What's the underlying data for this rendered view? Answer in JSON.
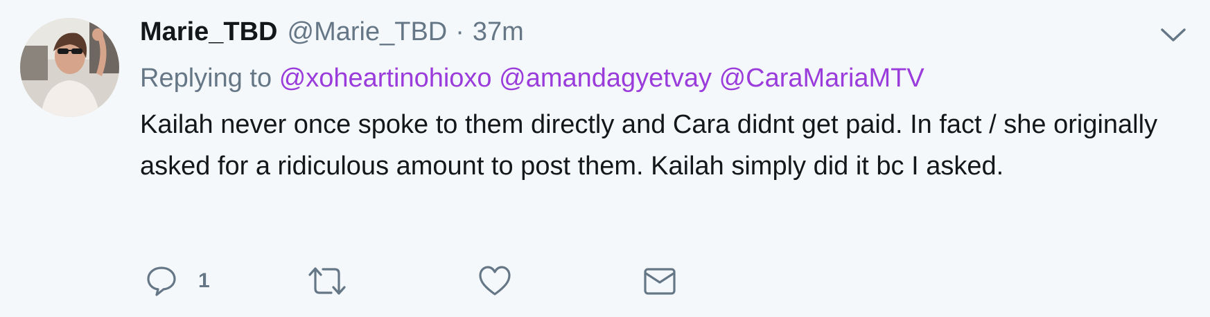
{
  "tweet": {
    "fullname": "Marie_TBD",
    "username": "@Marie_TBD",
    "separator": "·",
    "time": "37m",
    "reply_prefix": "Replying to",
    "mentions": [
      "@xoheartinohioxo",
      "@amandagyetvay",
      "@CaraMariaMTV"
    ],
    "text": "Kailah never once spoke to them directly and Cara didnt get paid. In fact / she originally asked for a ridiculous amount to post them. Kailah simply did it bc I asked.",
    "reply_count": "1"
  },
  "icons": {
    "avatar": "profile-photo",
    "caret": "chevron-down-icon",
    "reply": "reply-icon",
    "retweet": "retweet-icon",
    "like": "heart-icon",
    "message": "envelope-icon"
  },
  "colors": {
    "background": "#f5f8fa",
    "text": "#14171a",
    "muted": "#657786",
    "mention": "#9a3cdb"
  }
}
